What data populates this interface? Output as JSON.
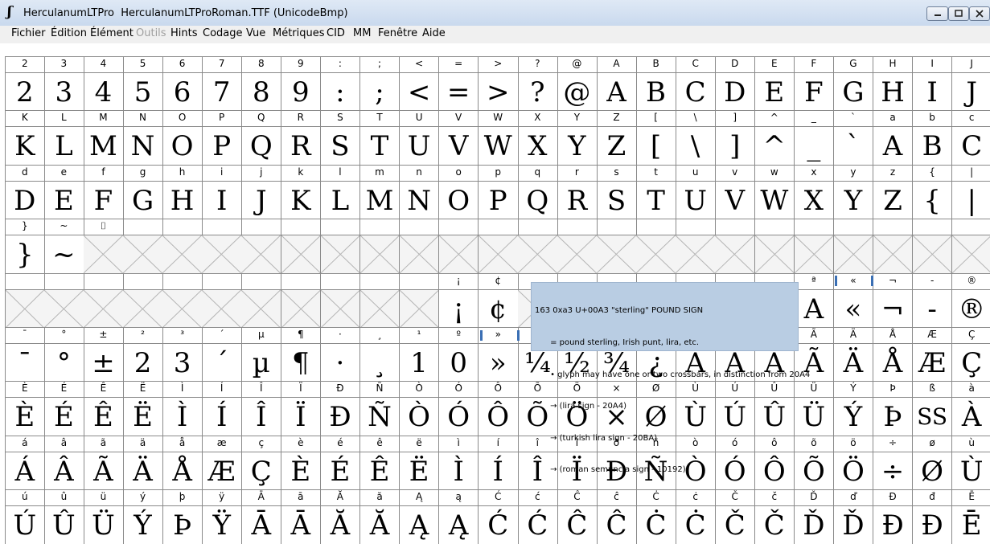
{
  "window": {
    "title": "HerculanumLTPro  HerculanumLTProRoman.TTF (UnicodeBmp)",
    "app_icon": "fontforge-icon",
    "buttons": [
      "minimize-icon",
      "maximize-icon",
      "close-icon"
    ]
  },
  "menu": {
    "items": [
      {
        "label": "Fichier",
        "enabled": true
      },
      {
        "label": "Édition",
        "enabled": true
      },
      {
        "label": "Élément",
        "enabled": true
      },
      {
        "label": "Outils",
        "enabled": false
      },
      {
        "label": "Hints",
        "enabled": true
      },
      {
        "label": "Codage",
        "enabled": true
      },
      {
        "label": "Vue",
        "enabled": true
      },
      {
        "label": "Métriques",
        "enabled": true
      },
      {
        "label": "CID",
        "enabled": true
      },
      {
        "label": "MM",
        "enabled": true
      },
      {
        "label": "Fenêtre",
        "enabled": true
      },
      {
        "label": "Aide",
        "enabled": true
      }
    ]
  },
  "grid": {
    "rows": [
      {
        "labels": [
          "2",
          "3",
          "4",
          "5",
          "6",
          "7",
          "8",
          "9",
          ":",
          ";",
          "<",
          "=",
          ">",
          "?",
          "@",
          "A",
          "B",
          "C",
          "D",
          "E",
          "F",
          "G",
          "H",
          "I",
          "J"
        ],
        "glyphs": [
          "2",
          "3",
          "4",
          "5",
          "6",
          "7",
          "8",
          "9",
          ":",
          ";",
          "<",
          "=",
          ">",
          "?",
          "@",
          "A",
          "B",
          "C",
          "D",
          "E",
          "F",
          "G",
          "H",
          "I",
          "J"
        ]
      },
      {
        "labels": [
          "K",
          "L",
          "M",
          "N",
          "O",
          "P",
          "Q",
          "R",
          "S",
          "T",
          "U",
          "V",
          "W",
          "X",
          "Y",
          "Z",
          "[",
          "\\",
          "]",
          "^",
          "_",
          "`",
          "a",
          "b",
          "c"
        ],
        "glyphs": [
          "K",
          "L",
          "M",
          "N",
          "O",
          "P",
          "Q",
          "R",
          "S",
          "T",
          "U",
          "V",
          "W",
          "X",
          "Y",
          "Z",
          "[",
          "\\",
          "]",
          "^",
          "_",
          "`",
          "A",
          "B",
          "C"
        ]
      },
      {
        "labels": [
          "d",
          "e",
          "f",
          "g",
          "h",
          "i",
          "j",
          "k",
          "l",
          "m",
          "n",
          "o",
          "p",
          "q",
          "r",
          "s",
          "t",
          "u",
          "v",
          "w",
          "x",
          "y",
          "z",
          "{",
          "|"
        ],
        "glyphs": [
          "D",
          "E",
          "F",
          "G",
          "H",
          "I",
          "J",
          "K",
          "L",
          "M",
          "N",
          "O",
          "P",
          "Q",
          "R",
          "S",
          "T",
          "U",
          "V",
          "W",
          "X",
          "Y",
          "Z",
          "{",
          "|"
        ]
      },
      {
        "labels": [
          "}",
          "~",
          "⌷",
          "",
          "",
          "",
          "",
          "",
          "",
          "",
          "",
          "",
          "",
          "",
          "",
          "",
          "",
          "",
          "",
          "",
          "",
          "",
          "",
          "",
          ""
        ],
        "glyphs": [
          "}",
          "~",
          "",
          "",
          "",
          "",
          "",
          "",
          "",
          "",
          "",
          "",
          "",
          "",
          "",
          "",
          "",
          "",
          "",
          "",
          "",
          "",
          "",
          "",
          ""
        ]
      },
      {
        "labels": [
          "",
          "",
          "",
          "",
          "",
          "",
          "",
          "",
          "",
          "",
          "",
          "¡",
          "¢",
          "",
          "",
          "",
          "",
          "",
          "",
          "",
          "ª",
          "«",
          "¬",
          "-",
          "®"
        ],
        "glyphs": [
          "",
          "",
          "",
          "",
          "",
          "",
          "",
          "",
          "",
          "",
          "",
          "¡",
          "¢",
          "",
          "",
          "",
          "",
          "",
          "",
          "",
          "A",
          "«",
          "¬",
          "-",
          "®"
        ]
      },
      {
        "labels": [
          "¯",
          "°",
          "±",
          "²",
          "³",
          "´",
          "µ",
          "¶",
          "·",
          "¸",
          "¹",
          "º",
          "»",
          "¼",
          "½",
          "¾",
          "¿",
          "À",
          "Á",
          "Â",
          "Ã",
          "Ä",
          "Å",
          "Æ",
          "Ç"
        ],
        "glyphs": [
          "¯",
          "°",
          "±",
          "2",
          "3",
          "´",
          "µ",
          "¶",
          "·",
          "¸",
          "1",
          "0",
          "»",
          "¼",
          "½",
          "¾",
          "¿",
          "À",
          "Á",
          "Â",
          "Ã",
          "Ä",
          "Å",
          "Æ",
          "Ç"
        ]
      },
      {
        "labels": [
          "È",
          "É",
          "Ê",
          "Ë",
          "Ì",
          "Í",
          "Î",
          "Ï",
          "Ð",
          "Ñ",
          "Ò",
          "Ó",
          "Ô",
          "Õ",
          "Ö",
          "×",
          "Ø",
          "Ù",
          "Ú",
          "Û",
          "Ü",
          "Ý",
          "Þ",
          "ß",
          "à"
        ],
        "glyphs": [
          "È",
          "É",
          "Ê",
          "Ë",
          "Ì",
          "Í",
          "Î",
          "Ï",
          "Ð",
          "Ñ",
          "Ò",
          "Ó",
          "Ô",
          "Õ",
          "Ö",
          "×",
          "Ø",
          "Ù",
          "Ú",
          "Û",
          "Ü",
          "Ý",
          "Þ",
          "SS",
          "À"
        ]
      },
      {
        "labels": [
          "á",
          "â",
          "ã",
          "ä",
          "å",
          "æ",
          "ç",
          "è",
          "é",
          "ê",
          "ë",
          "ì",
          "í",
          "î",
          "ï",
          "ð",
          "ñ",
          "ò",
          "ó",
          "ô",
          "õ",
          "ö",
          "÷",
          "ø",
          "ù"
        ],
        "glyphs": [
          "Á",
          "Â",
          "Ã",
          "Ä",
          "Å",
          "Æ",
          "Ç",
          "È",
          "É",
          "Ê",
          "Ë",
          "Ì",
          "Í",
          "Î",
          "Ï",
          "Ð",
          "Ñ",
          "Ò",
          "Ó",
          "Ô",
          "Õ",
          "Ö",
          "÷",
          "Ø",
          "Ù"
        ]
      },
      {
        "labels": [
          "ú",
          "û",
          "ü",
          "ý",
          "þ",
          "ÿ",
          "Ā",
          "ā",
          "Ă",
          "ă",
          "Ą",
          "ą",
          "Ć",
          "ć",
          "Ĉ",
          "ĉ",
          "Ċ",
          "ċ",
          "Č",
          "č",
          "Ď",
          "ď",
          "Đ",
          "đ",
          "Ē"
        ],
        "glyphs": [
          "Ú",
          "Û",
          "Ü",
          "Ý",
          "Þ",
          "Ÿ",
          "Ā",
          "Ā",
          "Ă",
          "Ă",
          "Ą",
          "Ą",
          "Ć",
          "Ć",
          "Ĉ",
          "Ĉ",
          "Ċ",
          "Ċ",
          "Č",
          "Č",
          "Ď",
          "Ď",
          "Đ",
          "Đ",
          "Ē"
        ]
      }
    ]
  },
  "tooltip": {
    "lines": [
      "163 0xa3 U+00A3 \"sterling\" POUND SIGN",
      "      = pound sterling, Irish punt, lira, etc.",
      "      • glyph may have one or two crossbars, in distinction from 20A4",
      "      → (lira sign - 20A4)",
      "      → (turkish lira sign - 20BA)",
      "      → (roman semuncia sign - 10192)"
    ]
  }
}
